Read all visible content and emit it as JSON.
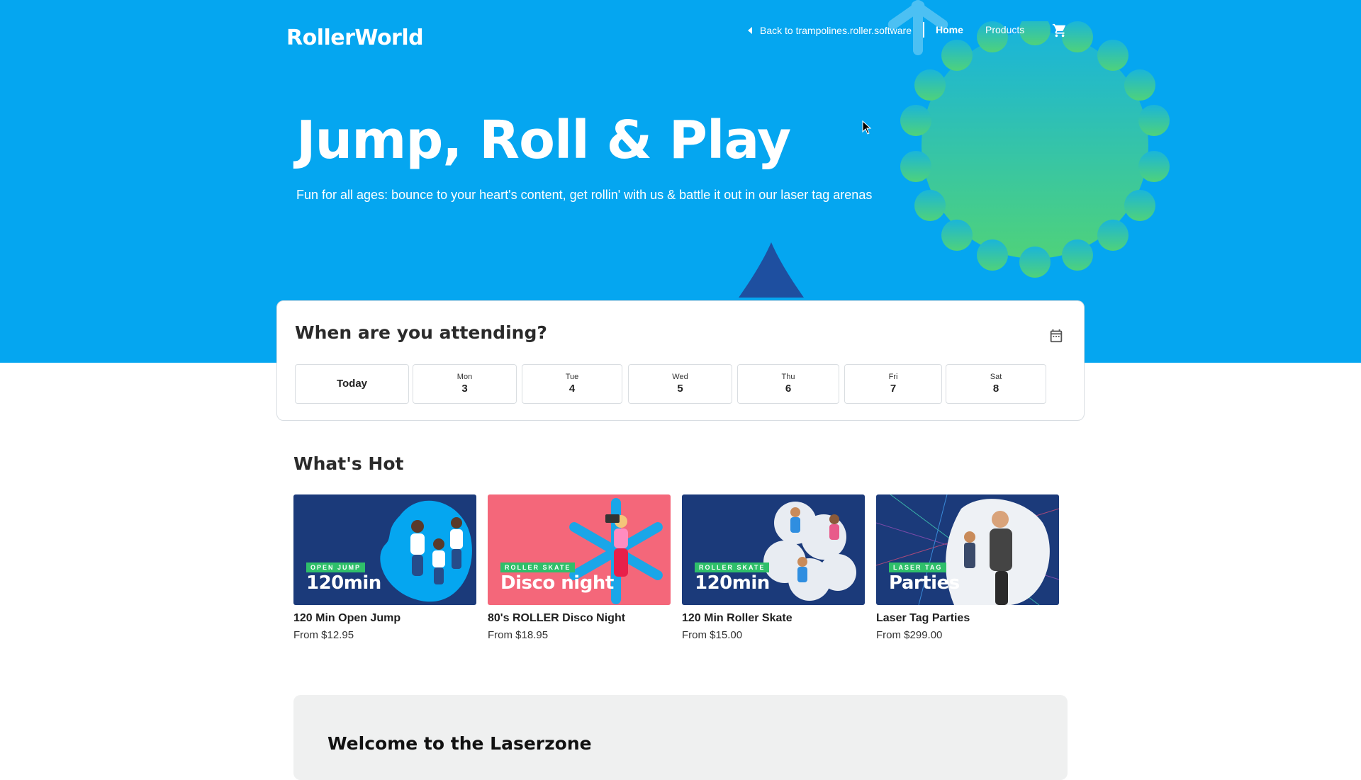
{
  "brand": {
    "logo_text": "RollerWorld"
  },
  "nav": {
    "back_label": "Back to trampolines.roller.software",
    "home_label": "Home",
    "products_label": "Products",
    "cart_icon": "cart-icon"
  },
  "hero": {
    "title": "Jump, Roll & Play",
    "subtitle": "Fun for all ages: bounce to your heart's content, get rollin' with us & battle it out in our laser tag arenas"
  },
  "date_picker": {
    "heading": "When are you attending?",
    "calendar_icon": "calendar-icon",
    "days": [
      {
        "dow": "",
        "num": "Today"
      },
      {
        "dow": "Mon",
        "num": "3"
      },
      {
        "dow": "Tue",
        "num": "4"
      },
      {
        "dow": "Wed",
        "num": "5"
      },
      {
        "dow": "Thu",
        "num": "6"
      },
      {
        "dow": "Fri",
        "num": "7"
      },
      {
        "dow": "Sat",
        "num": "8"
      }
    ]
  },
  "whats_hot": {
    "heading": "What's Hot",
    "products": [
      {
        "name": "120 Min Open Jump",
        "price": "From $12.95",
        "tag": "OPEN JUMP",
        "big": "120min",
        "bg": "#1b3a7a",
        "tag_color": "#2fbf6a"
      },
      {
        "name": "80's ROLLER Disco Night",
        "price": "From $18.95",
        "tag": "ROLLER SKATE",
        "big": "Disco night",
        "bg": "#f4677a",
        "tag_color": "#2fbf6a"
      },
      {
        "name": "120 Min Roller Skate",
        "price": "From $15.00",
        "tag": "ROLLER SKATE",
        "big": "120min",
        "bg": "#1b3a7a",
        "tag_color": "#2fbf6a"
      },
      {
        "name": "Laser Tag Parties",
        "price": "From $299.00",
        "tag": "LASER TAG",
        "big": "Parties",
        "bg": "#1b3a7a",
        "tag_color": "#2fbf6a"
      }
    ]
  },
  "welcome": {
    "heading": "Welcome to the Laserzone"
  },
  "colors": {
    "hero_bg": "#05a6f0",
    "accent_green": "#3fc86a",
    "navy": "#1b3a7a"
  }
}
